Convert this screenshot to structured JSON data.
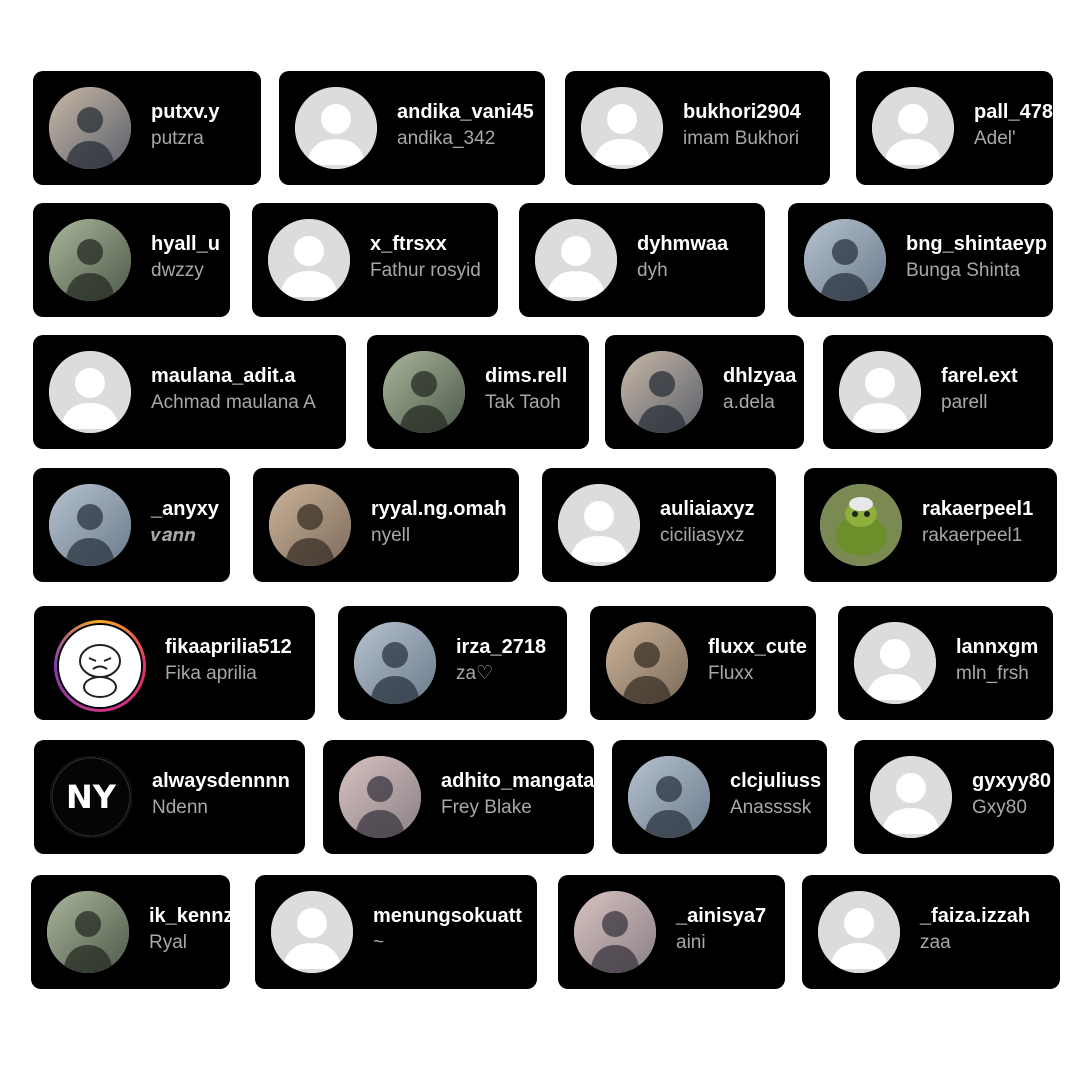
{
  "accounts": [
    {
      "username": "putxv.y",
      "name": "putzra",
      "avatar": "anime-boy-photo"
    },
    {
      "username": "andika_vani45",
      "name": "andika_342",
      "avatar": "default-avatar"
    },
    {
      "username": "bukhori2904",
      "name": "imam Bukhori",
      "avatar": "default-avatar"
    },
    {
      "username": "pall_478",
      "name": "Adel'",
      "avatar": "default-avatar"
    },
    {
      "username": "hyall_u",
      "name": "dwzzy",
      "avatar": "anime-character-photo"
    },
    {
      "username": "x_ftrsxx",
      "name": "Fathur rosyid",
      "avatar": "default-avatar"
    },
    {
      "username": "dyhmwaa",
      "name": "dyh",
      "avatar": "default-avatar"
    },
    {
      "username": "bng_shintaeyp",
      "name": "Bunga Shinta",
      "avatar": "photo"
    },
    {
      "username": "maulana_adit.a",
      "name": "Achmad maulana A",
      "avatar": "default-avatar"
    },
    {
      "username": "dims.rell",
      "name": "Tak Taoh",
      "avatar": "photo"
    },
    {
      "username": "dhlzyaa",
      "name": "a.dela",
      "avatar": "photo"
    },
    {
      "username": "farel.ext",
      "name": "parell",
      "avatar": "default-avatar"
    },
    {
      "username": "_anyxy",
      "name": "𝒗𝒂𝒏𝒏",
      "avatar": "anime-girl-photo"
    },
    {
      "username": "ryyal.ng.omah",
      "name": "nyell",
      "avatar": "photo"
    },
    {
      "username": "auliaiaxyz",
      "name": "ciciliasyxz",
      "avatar": "default-avatar"
    },
    {
      "username": "rakaerpeel1",
      "name": "rakaerpeel1",
      "avatar": "turtle-photo"
    },
    {
      "username": "fikaaprilia512",
      "name": "Fika aprilia",
      "avatar": "cartoon-story-ring"
    },
    {
      "username": "irza_2718",
      "name": "za♡",
      "avatar": "photo"
    },
    {
      "username": "fluxx_cute",
      "name": "Fluxx",
      "avatar": "photo"
    },
    {
      "username": "lannxgm",
      "name": "mln_frsh",
      "avatar": "default-avatar"
    },
    {
      "username": "alwaysdennnn",
      "name": "Ndenn",
      "avatar": "logo-ny"
    },
    {
      "username": "adhito_mangata",
      "name": "Frey Blake",
      "avatar": "painting-photo"
    },
    {
      "username": "clcjuliuss",
      "name": "Anassssk",
      "avatar": "photo"
    },
    {
      "username": "gyxyy80",
      "name": "Gxy80",
      "avatar": "default-avatar"
    },
    {
      "username": "ik_kennz",
      "name": "Ryal",
      "avatar": "sketch-photo"
    },
    {
      "username": "menungsokuatt",
      "name": "~",
      "avatar": "default-avatar"
    },
    {
      "username": "_ainisya7",
      "name": "aini",
      "avatar": "photo"
    },
    {
      "username": "_faiza.izzah",
      "name": "zaa",
      "avatar": "default-avatar"
    }
  ],
  "avatar_logo_text": "NY",
  "colors": {
    "card_bg": "#000000",
    "username": "#ffffff",
    "name": "#a8a8a8",
    "default_avatar_bg": "#dcdcdc",
    "default_avatar_fg": "#ffffff",
    "story_ring": "#e1306c"
  }
}
